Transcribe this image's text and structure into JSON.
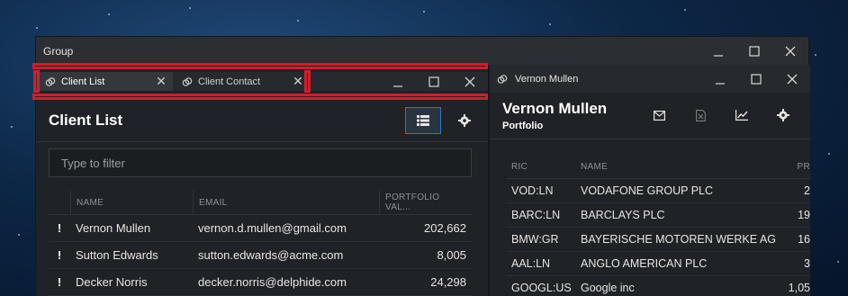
{
  "group_window": {
    "title": "Group"
  },
  "left_pane": {
    "tabs": [
      {
        "label": "Client List",
        "active": true
      },
      {
        "label": "Client Contact",
        "active": false
      }
    ],
    "title": "Client List",
    "filter_placeholder": "Type to filter",
    "columns": [
      "NAME",
      "EMAIL",
      "PORTFOLIO VAL..."
    ],
    "rows": [
      {
        "flag": "!",
        "name": "Vernon Mullen",
        "email": "vernon.d.mullen@gmail.com",
        "value": "202,662"
      },
      {
        "flag": "!",
        "name": "Sutton Edwards",
        "email": "sutton.edwards@acme.com",
        "value": "8,005"
      },
      {
        "flag": "!",
        "name": "Decker Norris",
        "email": "decker.norris@delphide.com",
        "value": "24,298"
      }
    ]
  },
  "right_pane": {
    "window_title": "Vernon Mullen",
    "title": "Vernon Mullen",
    "subtitle": "Portfolio",
    "columns": [
      "RIC",
      "NAME",
      "PR"
    ],
    "rows": [
      {
        "ric": "VOD:LN",
        "name": "VODAFONE GROUP PLC",
        "pr": "2"
      },
      {
        "ric": "BARC:LN",
        "name": "BARCLAYS PLC",
        "pr": "19"
      },
      {
        "ric": "BMW:GR",
        "name": "BAYERISCHE MOTOREN WERKE AG",
        "pr": "16"
      },
      {
        "ric": "AAL:LN",
        "name": "ANGLO AMERICAN PLC",
        "pr": "3"
      },
      {
        "ric": "GOOGL:US",
        "name": "Google inc",
        "pr": "1,05"
      }
    ]
  },
  "colors": {
    "highlight": "#d21e2a",
    "accent": "#2d79c6"
  },
  "icons": [
    "link-icon",
    "close-icon",
    "minimize-icon",
    "maximize-icon",
    "list-view-icon",
    "settings-icon",
    "email-icon",
    "excel-icon",
    "chart-icon"
  ]
}
